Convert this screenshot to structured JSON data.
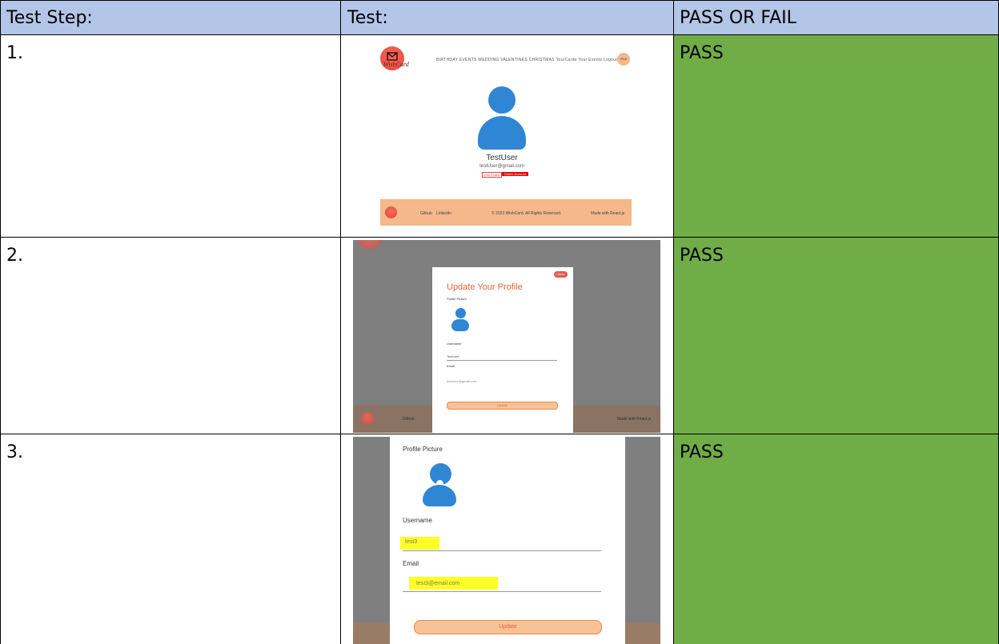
{
  "table": {
    "headers": [
      "Test Step:",
      "Test:",
      "PASS OR FAIL"
    ],
    "rows": [
      {
        "step": "1.",
        "result": "PASS"
      },
      {
        "step": "2.",
        "result": "PASS"
      },
      {
        "step": "3.",
        "result": "PASS"
      }
    ]
  },
  "colors": {
    "header": "#b4c6e7",
    "pass": "#70ad47",
    "accent": "#f4b88b",
    "avatar": "#2f86d5"
  },
  "shot1": {
    "logo_text": "WishCard",
    "nav": "BIRTHDAY  EVENTS  WEDDING  VALENTINES  CHRISTMAS  YourCards  Your Events  Logout",
    "nav_avatar": "Prof",
    "username": "TestUser",
    "email": "testUser@gmail.com",
    "edit_label": "Edit Profile",
    "delete_label": "Delete Account",
    "footer_github": "Github",
    "footer_linkedin": "LinkedIn",
    "footer_copy": "© 2023 WishCard. All Rights Reserved.",
    "footer_made": "Made with React.js"
  },
  "shot2": {
    "close": "Close",
    "title": "Update Your Profile",
    "profile_picture": "Profile Picture",
    "username_label": "Username",
    "username_value": "TestUser",
    "email_label": "Email",
    "email_value": "testUser@gmail.com",
    "update": "Update",
    "footer_github": "Github",
    "footer_made": "Made with React.js"
  },
  "shot3": {
    "profile_picture": "Profile Picture",
    "username_label": "Username",
    "username_value": "test3",
    "email_label": "Email",
    "email_value": "test3@email.com",
    "update": "Update"
  }
}
